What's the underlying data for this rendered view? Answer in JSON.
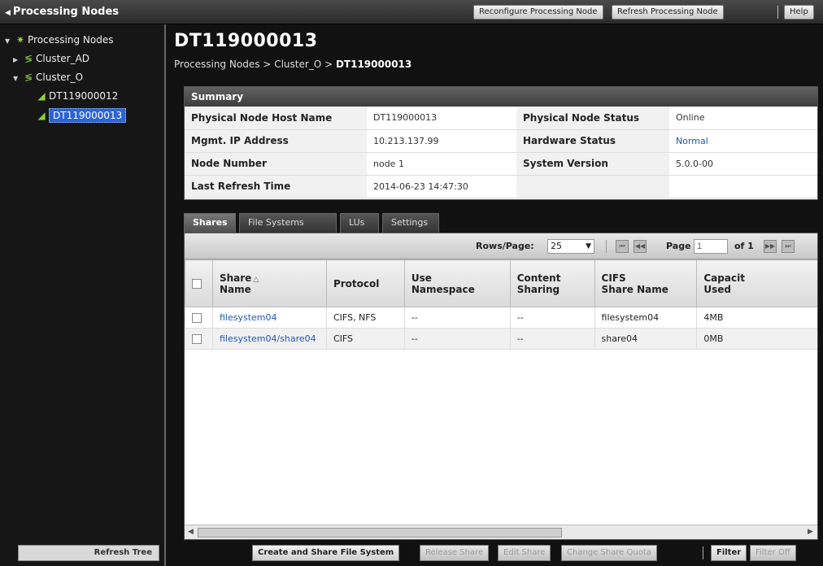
{
  "header": {
    "title": "Processing Nodes",
    "buttons": {
      "reconfigure": "Reconfigure Processing Node",
      "refresh": "Refresh Processing Node",
      "help": "Help"
    }
  },
  "tree": {
    "root": "Processing Nodes",
    "items": [
      "Cluster_AD",
      "Cluster_O",
      "DT119000012",
      "DT119000013"
    ],
    "refresh_label": "Refresh Tree"
  },
  "page": {
    "title": "DT119000013",
    "breadcrumb": {
      "part1": "Processing Nodes",
      "sep": ">",
      "part2": "Cluster_O",
      "part3": "DT119000013"
    }
  },
  "summary": {
    "header": "Summary",
    "rows": [
      {
        "k1": "Physical Node Host Name",
        "v1": "DT119000013",
        "k2": "Physical Node Status",
        "v2": "Online"
      },
      {
        "k1": "Mgmt. IP Address",
        "v1": "10.213.137.99",
        "k2": "Hardware Status",
        "v2": "Normal"
      },
      {
        "k1": "Node Number",
        "v1": "node 1",
        "k2": "System Version",
        "v2": "5.0.0-00"
      },
      {
        "k1": "Last Refresh Time",
        "v1": "2014-06-23 14:47:30",
        "k2": "",
        "v2": ""
      }
    ]
  },
  "tabs": [
    "Shares",
    "File Systems",
    "LUs",
    "Settings"
  ],
  "pager": {
    "rows_label": "Rows/Page:",
    "rows_value": "25",
    "page_label": "Page",
    "page_value": "1",
    "of_label": "of 1"
  },
  "table": {
    "headers": {
      "share_name_1": "Share",
      "share_name_2": "Name",
      "protocol": "Protocol",
      "use_ns_1": "Use",
      "use_ns_2": "Namespace",
      "content_1": "Content",
      "content_2": "Sharing",
      "cifs_1": "CIFS",
      "cifs_2": "Share Name",
      "capacity": "Capacit",
      "used": "Used"
    },
    "rows": [
      {
        "name": "filesystem04",
        "protocol": "CIFS, NFS",
        "namespace": "--",
        "content": "--",
        "cifs": "filesystem04",
        "used": "4MB"
      },
      {
        "name": "filesystem04/share04",
        "protocol": "CIFS",
        "namespace": "--",
        "content": "--",
        "cifs": "share04",
        "used": "0MB"
      }
    ]
  },
  "actions": {
    "create": "Create and Share File System",
    "release": "Release Share",
    "edit": "Edit Share",
    "quota": "Change Share Quota",
    "filter": "Filter",
    "filter_off": "Filter Off"
  },
  "colors": {
    "selection": "#2c63d6",
    "link": "#2155b8",
    "tree_icon": "#8dd13c"
  }
}
